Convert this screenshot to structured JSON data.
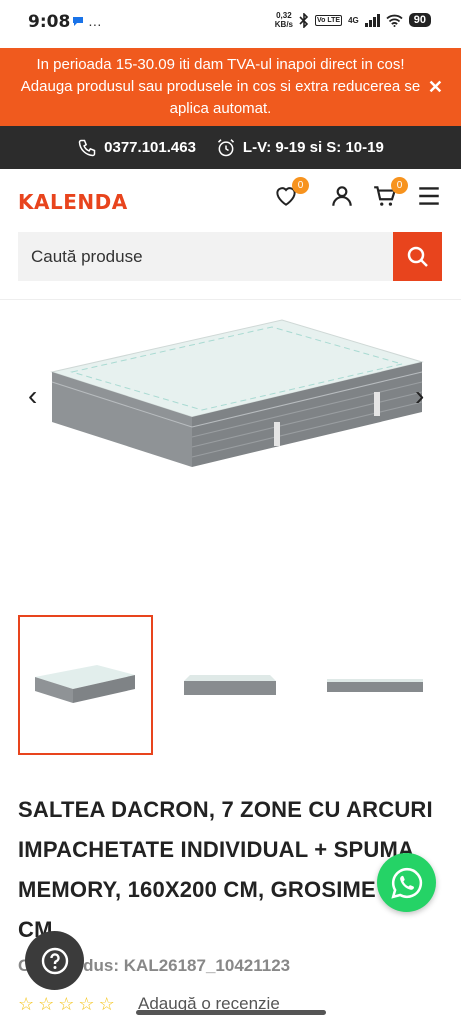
{
  "status": {
    "time": "9:08",
    "net_speed_value": "0,32",
    "net_speed_unit": "KB/s",
    "volte": "Vo LTE",
    "network": "4G",
    "battery": "90"
  },
  "promo": {
    "text": "In perioada 15-30.09 iti dam TVA-ul inapoi direct in cos! Adauga produsul sau produsele in cos si extra reducerea se aplica automat."
  },
  "contact": {
    "phone": "0377.101.463",
    "hours": "L-V: 9-19 si S: 10-19"
  },
  "header": {
    "logo": "KALENDA",
    "wishlist_count": "0",
    "cart_count": "0"
  },
  "search": {
    "placeholder": "Caută produse"
  },
  "product": {
    "title": "SALTEA DACRON, 7 ZONE CU ARCURI IMPACHETATE INDIVIDUAL + SPUMA MEMORY, 160X200 CM, GROSIME 28 CM",
    "code": "Cod produs: KAL26187_10421123",
    "review_link": "Adaugă o recenzie",
    "rating": 0
  },
  "colors": {
    "accent": "#e8441d",
    "promo_bg": "#f05a1e",
    "contact_bg": "#2c2c2c",
    "badge": "#f7931e",
    "whatsapp": "#25d366"
  }
}
